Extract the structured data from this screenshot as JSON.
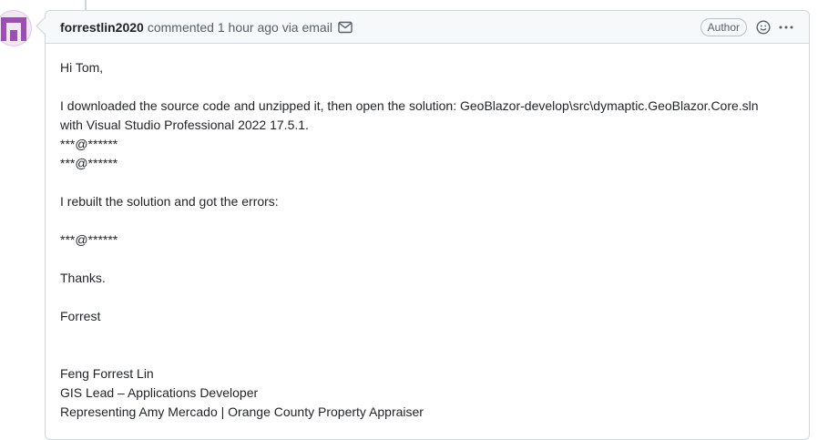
{
  "comment": {
    "author": "forrestlin2020",
    "meta": "commented 1 hour ago via email",
    "badge": "Author",
    "body": {
      "greeting": "Hi Tom,",
      "line1": "I downloaded the source code and unzipped it, then open the solution: GeoBlazor-develop\\src\\dymaptic.GeoBlazor.Core.sln",
      "line2": "with Visual Studio Professional 2022 17.5.1.",
      "redacted1": "***@******",
      "redacted2": "***@******",
      "line3": "I rebuilt the solution and got the errors:",
      "redacted3": "***@******",
      "thanks": "Thanks.",
      "signoff": "Forrest",
      "sig_name": "Feng Forrest Lin",
      "sig_title": "GIS Lead – Applications Developer",
      "sig_org": "Representing Amy Mercado | Orange County Property Appraiser"
    }
  },
  "icons": {
    "mail": "mail-icon",
    "emoji": "smiley-icon",
    "more": "kebab-horizontal-icon"
  },
  "colors": {
    "avatar": "#9b4fb0",
    "header_bg": "#f6f8fa",
    "border": "#d0d7de"
  }
}
